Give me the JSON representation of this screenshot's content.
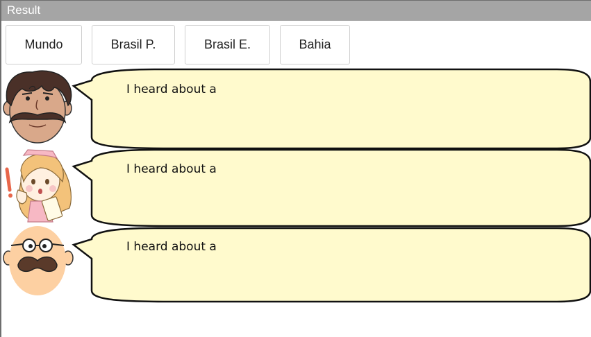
{
  "window": {
    "title": "Result"
  },
  "tabs": [
    {
      "label": "Mundo"
    },
    {
      "label": "Brasil P."
    },
    {
      "label": "Brasil E."
    },
    {
      "label": "Bahia"
    }
  ],
  "dialogue": [
    {
      "speaker_icon": "mustached-man-face-icon",
      "text": "I heard about a"
    },
    {
      "speaker_icon": "nurse-girl-icon",
      "text": "I heard about a"
    },
    {
      "speaker_icon": "bald-man-glasses-icon",
      "text": "I heard about a"
    }
  ],
  "colors": {
    "titlebar": "#a5a5a5",
    "bubble_fill": "#fffacd",
    "bubble_stroke": "#111111"
  }
}
